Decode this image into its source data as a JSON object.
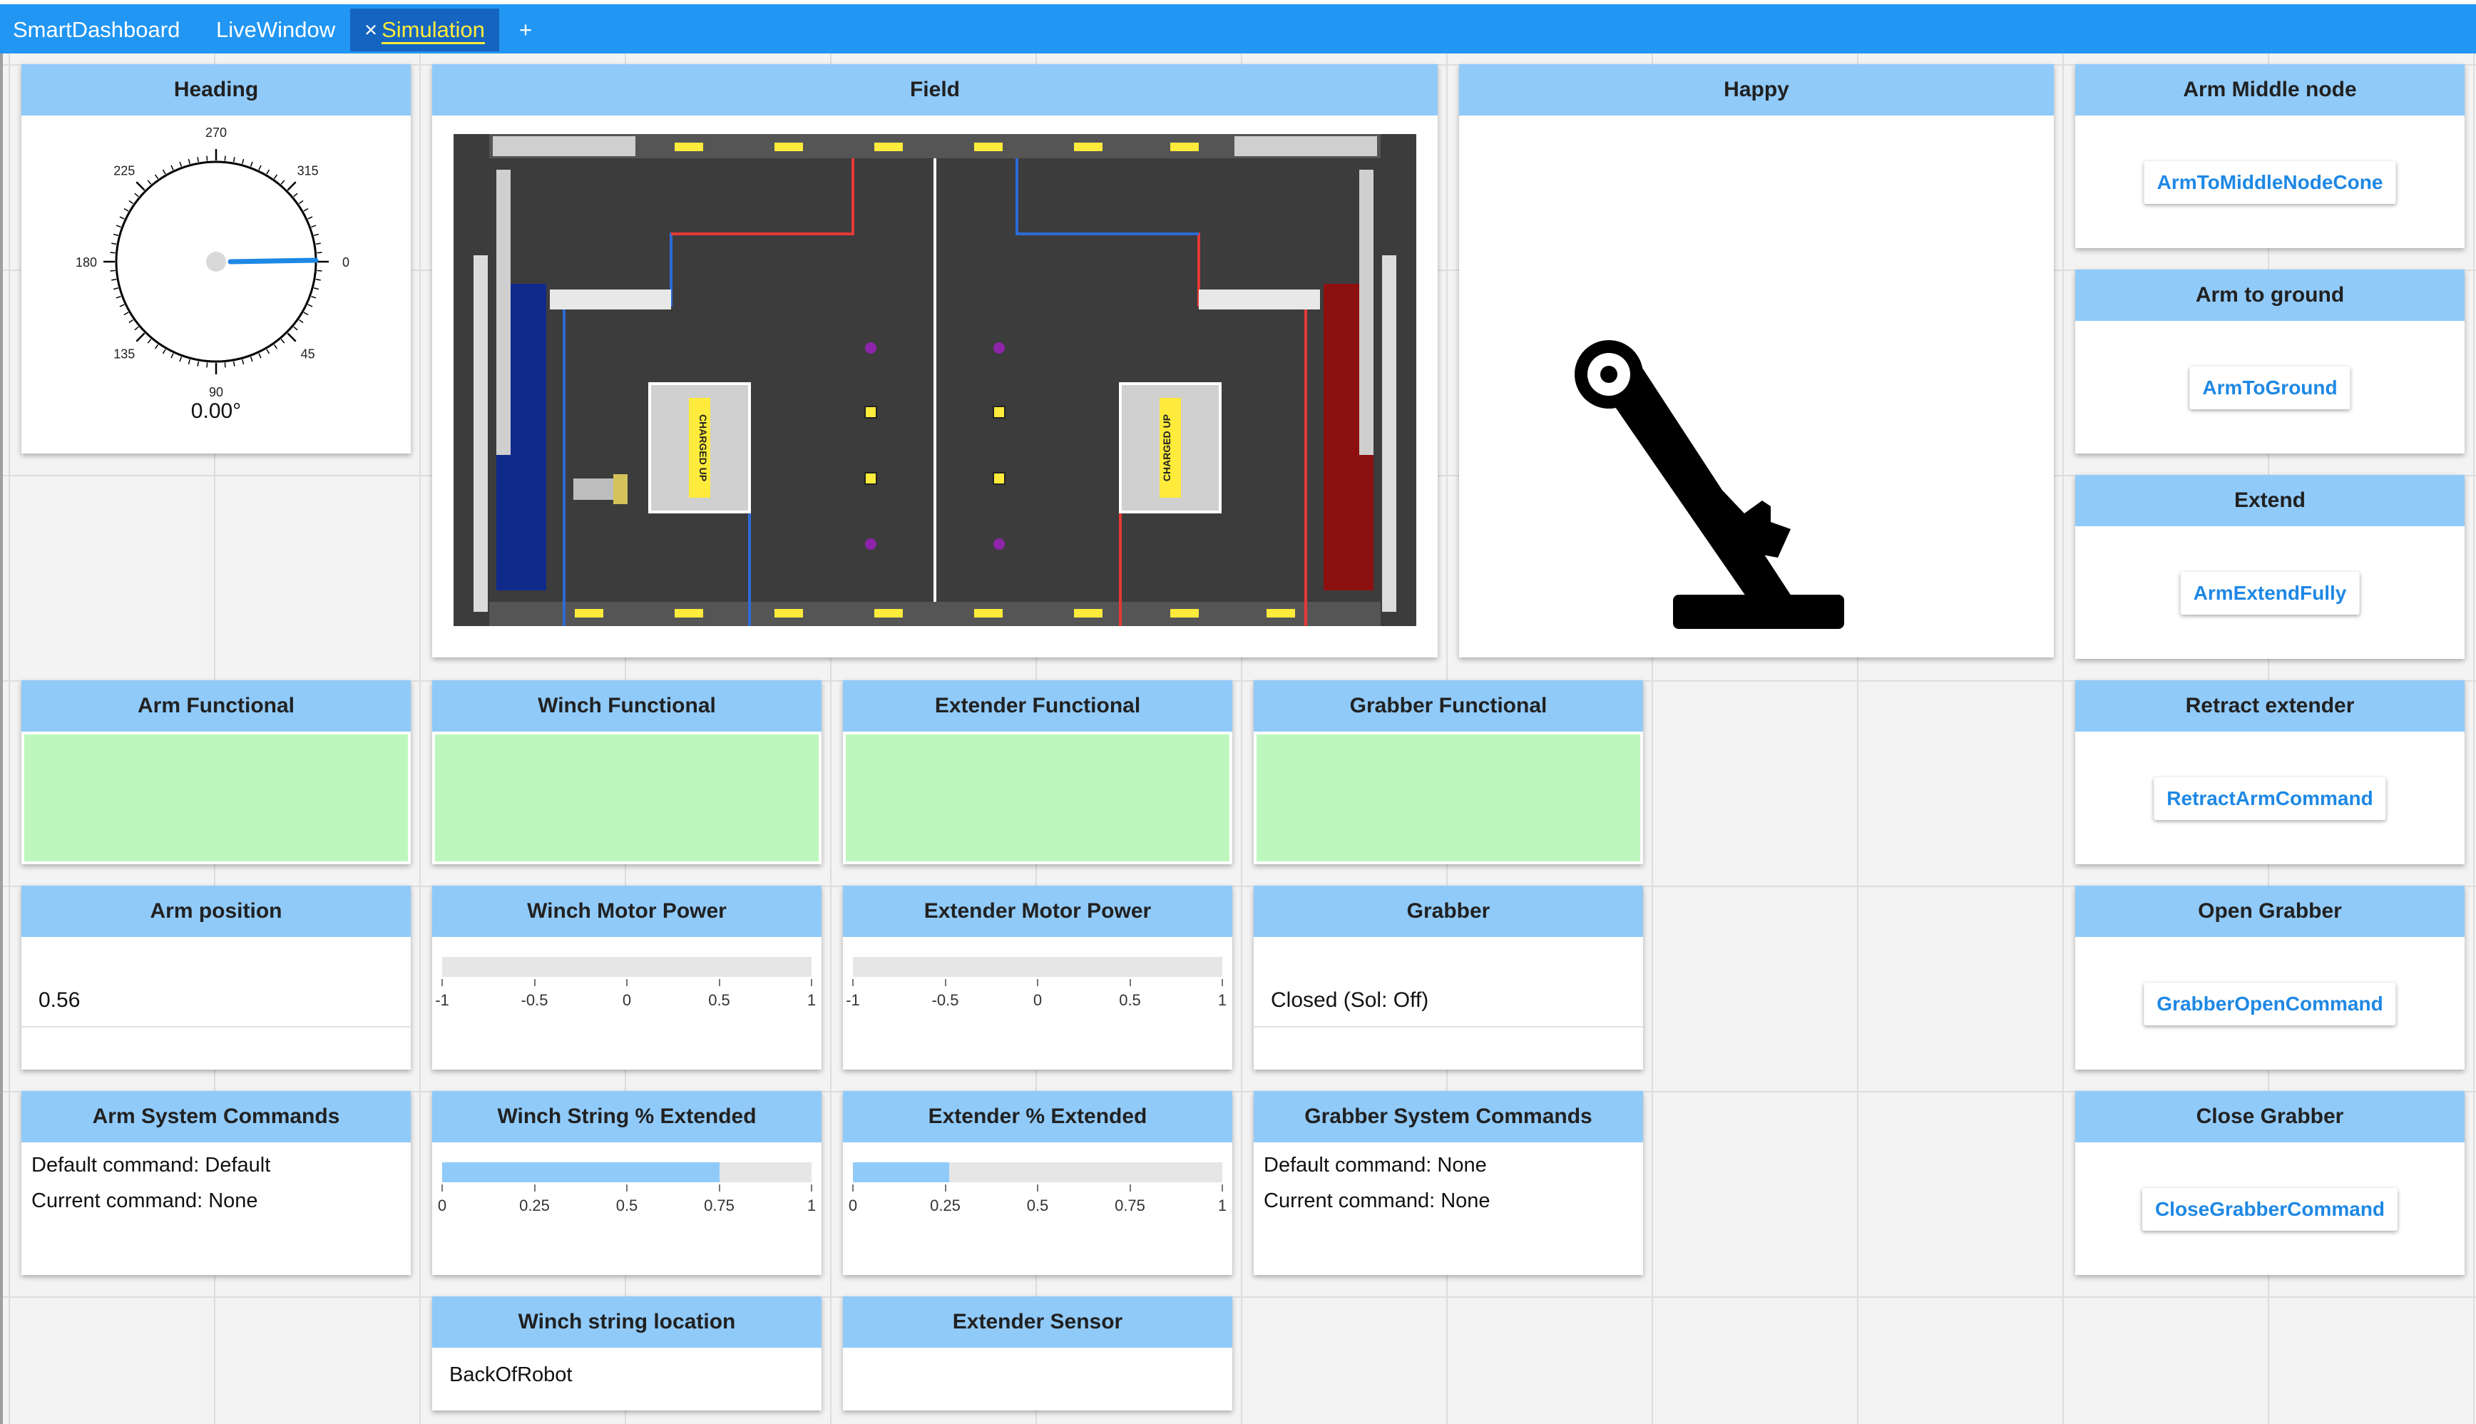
{
  "tabs": [
    {
      "label": "SmartDashboard"
    },
    {
      "label": "LiveWindow"
    },
    {
      "label": "Simulation",
      "close": "×"
    },
    {
      "label": "+"
    }
  ],
  "heading": {
    "title": "Heading",
    "readout": "0.00°",
    "value": 0,
    "ticks": [
      "270",
      "315",
      "0",
      "45",
      "90",
      "135",
      "180",
      "225"
    ]
  },
  "field": {
    "title": "Field",
    "field_text": "CHARGED UP"
  },
  "happy": {
    "title": "Happy"
  },
  "arm_middle": {
    "title": "Arm Middle node",
    "button": "ArmToMiddleNodeCone"
  },
  "arm_ground": {
    "title": "Arm to ground",
    "button": "ArmToGround"
  },
  "extend": {
    "title": "Extend",
    "button": "ArmExtendFully"
  },
  "retract": {
    "title": "Retract extender",
    "button": "RetractArmCommand"
  },
  "open_grabber": {
    "title": "Open Grabber",
    "button": "GrabberOpenCommand"
  },
  "close_grabber": {
    "title": "Close Grabber",
    "button": "CloseGrabberCommand"
  },
  "arm_functional": {
    "title": "Arm Functional",
    "value": true,
    "color": "#bdf7bd"
  },
  "winch_functional": {
    "title": "Winch Functional",
    "value": true,
    "color": "#bdf7bd"
  },
  "extender_functional": {
    "title": "Extender Functional",
    "value": true,
    "color": "#bdf7bd"
  },
  "grabber_functional": {
    "title": "Grabber Functional",
    "value": true,
    "color": "#bdf7bd"
  },
  "arm_position": {
    "title": "Arm position",
    "value": "0.56"
  },
  "winch_motor": {
    "title": "Winch Motor Power",
    "value": 0,
    "ticks": [
      "-1",
      "-0.5",
      "0",
      "0.5",
      "1"
    ]
  },
  "extender_motor": {
    "title": "Extender Motor Power",
    "value": 0,
    "ticks": [
      "-1",
      "-0.5",
      "0",
      "0.5",
      "1"
    ]
  },
  "grabber": {
    "title": "Grabber",
    "value": "Closed (Sol: Off)"
  },
  "arm_cmds": {
    "title": "Arm System Commands",
    "default_cmd": "Default command: Default",
    "current_cmd": "Current command: None"
  },
  "winch_string": {
    "title": "Winch String % Extended",
    "value": 0.75,
    "ticks": [
      "0",
      "0.25",
      "0.5",
      "0.75",
      "1"
    ]
  },
  "extender_pct": {
    "title": "Extender % Extended",
    "value": 0.26,
    "ticks": [
      "0",
      "0.25",
      "0.5",
      "0.75",
      "1"
    ]
  },
  "grabber_cmds": {
    "title": "Grabber System Commands",
    "default_cmd": "Default command: None",
    "current_cmd": "Current command: None"
  },
  "winch_location": {
    "title": "Winch string location",
    "value": "BackOfRobot"
  },
  "extender_sensor": {
    "title": "Extender Sensor",
    "value": ""
  },
  "colors": {
    "tab_bar": "#2196f3",
    "widget_header": "#90caf9",
    "button_text": "#1e88e5",
    "boolean_true": "#bdf7bd",
    "accent": "#1e88e5"
  }
}
